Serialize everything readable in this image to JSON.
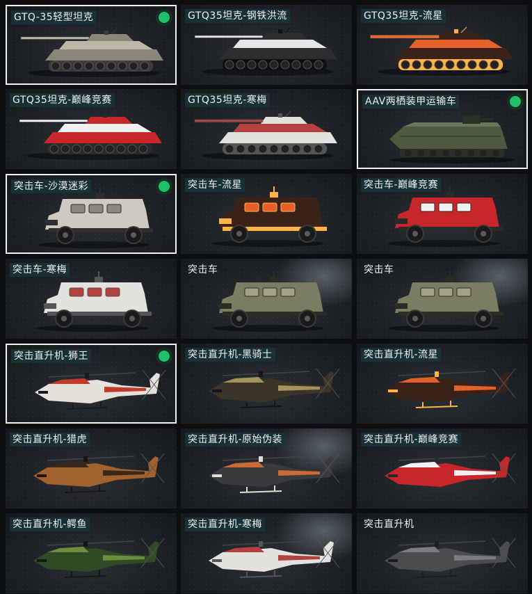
{
  "items": [
    {
      "label": "GTQ-35轻型坦克",
      "kind": "tank",
      "skin": "camo-grey",
      "selected": true,
      "equipped": true
    },
    {
      "label": "GTQ35坦克-钢铁洪流",
      "kind": "tank",
      "skin": "black-white",
      "selected": false,
      "equipped": false
    },
    {
      "label": "GTQ35坦克-流星",
      "kind": "tank",
      "skin": "meteor",
      "selected": false,
      "equipped": false
    },
    {
      "label": "GTQ35坦克-巅峰竞赛",
      "kind": "tank",
      "skin": "racing-red",
      "selected": false,
      "equipped": false
    },
    {
      "label": "GTQ35坦克-寒梅",
      "kind": "tank",
      "skin": "plum-white",
      "selected": false,
      "equipped": false
    },
    {
      "label": "AAV两栖装甲运输车",
      "kind": "amphibious",
      "skin": "green",
      "selected": true,
      "equipped": true
    },
    {
      "label": "突击车-沙漠迷彩",
      "kind": "car",
      "skin": "desert-camo",
      "selected": true,
      "equipped": true
    },
    {
      "label": "突击车-流星",
      "kind": "car",
      "skin": "meteor",
      "selected": false,
      "equipped": false
    },
    {
      "label": "突击车-巅峰竞赛",
      "kind": "car",
      "skin": "racing-red",
      "selected": false,
      "equipped": false
    },
    {
      "label": "突击车-寒梅",
      "kind": "car",
      "skin": "plum-white",
      "selected": false,
      "equipped": false
    },
    {
      "label": "突击车",
      "kind": "car",
      "skin": "olive",
      "selected": false,
      "equipped": false
    },
    {
      "label": "突击车",
      "kind": "car",
      "skin": "olive",
      "selected": false,
      "equipped": false
    },
    {
      "label": "突击直升机-狮王",
      "kind": "heli",
      "skin": "lion-king",
      "selected": true,
      "equipped": true
    },
    {
      "label": "突击直升机-黑骑士",
      "kind": "heli",
      "skin": "black-knight",
      "selected": false,
      "equipped": false
    },
    {
      "label": "突击直升机-流星",
      "kind": "heli",
      "skin": "meteor",
      "selected": false,
      "equipped": false
    },
    {
      "label": "突击直升机-猎虎",
      "kind": "heli",
      "skin": "tiger",
      "selected": false,
      "equipped": false
    },
    {
      "label": "突击直升机-原始伪装",
      "kind": "heli",
      "skin": "primitive-camo",
      "selected": false,
      "equipped": false
    },
    {
      "label": "突击直升机-巅峰竞赛",
      "kind": "heli",
      "skin": "racing-red",
      "selected": false,
      "equipped": false
    },
    {
      "label": "突击直升机-鳄鱼",
      "kind": "heli",
      "skin": "crocodile",
      "selected": false,
      "equipped": false
    },
    {
      "label": "突击直升机-寒梅",
      "kind": "heli",
      "skin": "plum-white",
      "selected": false,
      "equipped": false
    },
    {
      "label": "突击直升机",
      "kind": "heli",
      "skin": "grey",
      "selected": false,
      "equipped": false
    }
  ],
  "skins": {
    "camo-grey": {
      "body": "#8a8778",
      "accent": "#bdb8a6",
      "detail": "#3c3b36"
    },
    "black-white": {
      "body": "#2b2d2f",
      "accent": "#e6e6e6",
      "detail": "#111111"
    },
    "meteor": {
      "body": "#3a2218",
      "accent": "#e6602a",
      "detail": "#ffb347"
    },
    "racing-red": {
      "body": "#c8262a",
      "accent": "#f1f1f1",
      "detail": "#2a2a2a"
    },
    "plum-white": {
      "body": "#e4e2df",
      "accent": "#b44040",
      "detail": "#555555"
    },
    "green": {
      "body": "#4d5a40",
      "accent": "#6b7857",
      "detail": "#2a3022"
    },
    "desert-camo": {
      "body": "#cfcac0",
      "accent": "#8d887e",
      "detail": "#2e2e2e"
    },
    "olive": {
      "body": "#7b7d63",
      "accent": "#a1a287",
      "detail": "#2b2c24"
    },
    "lion-king": {
      "body": "#e5e2dc",
      "accent": "#c33a2c",
      "detail": "#1b1b1b"
    },
    "black-knight": {
      "body": "#3a3526",
      "accent": "#a7915d",
      "detail": "#141414"
    },
    "tiger": {
      "body": "#a2622d",
      "accent": "#3a2717",
      "detail": "#1b1410"
    },
    "primitive-camo": {
      "body": "#3a3a3c",
      "accent": "#cc6a38",
      "detail": "#e0ddd6"
    },
    "crocodile": {
      "body": "#2f4a25",
      "accent": "#6a8d40",
      "detail": "#121a0f"
    },
    "grey": {
      "body": "#4a4c4e",
      "accent": "#7a7c7e",
      "detail": "#1c1d1e"
    }
  }
}
